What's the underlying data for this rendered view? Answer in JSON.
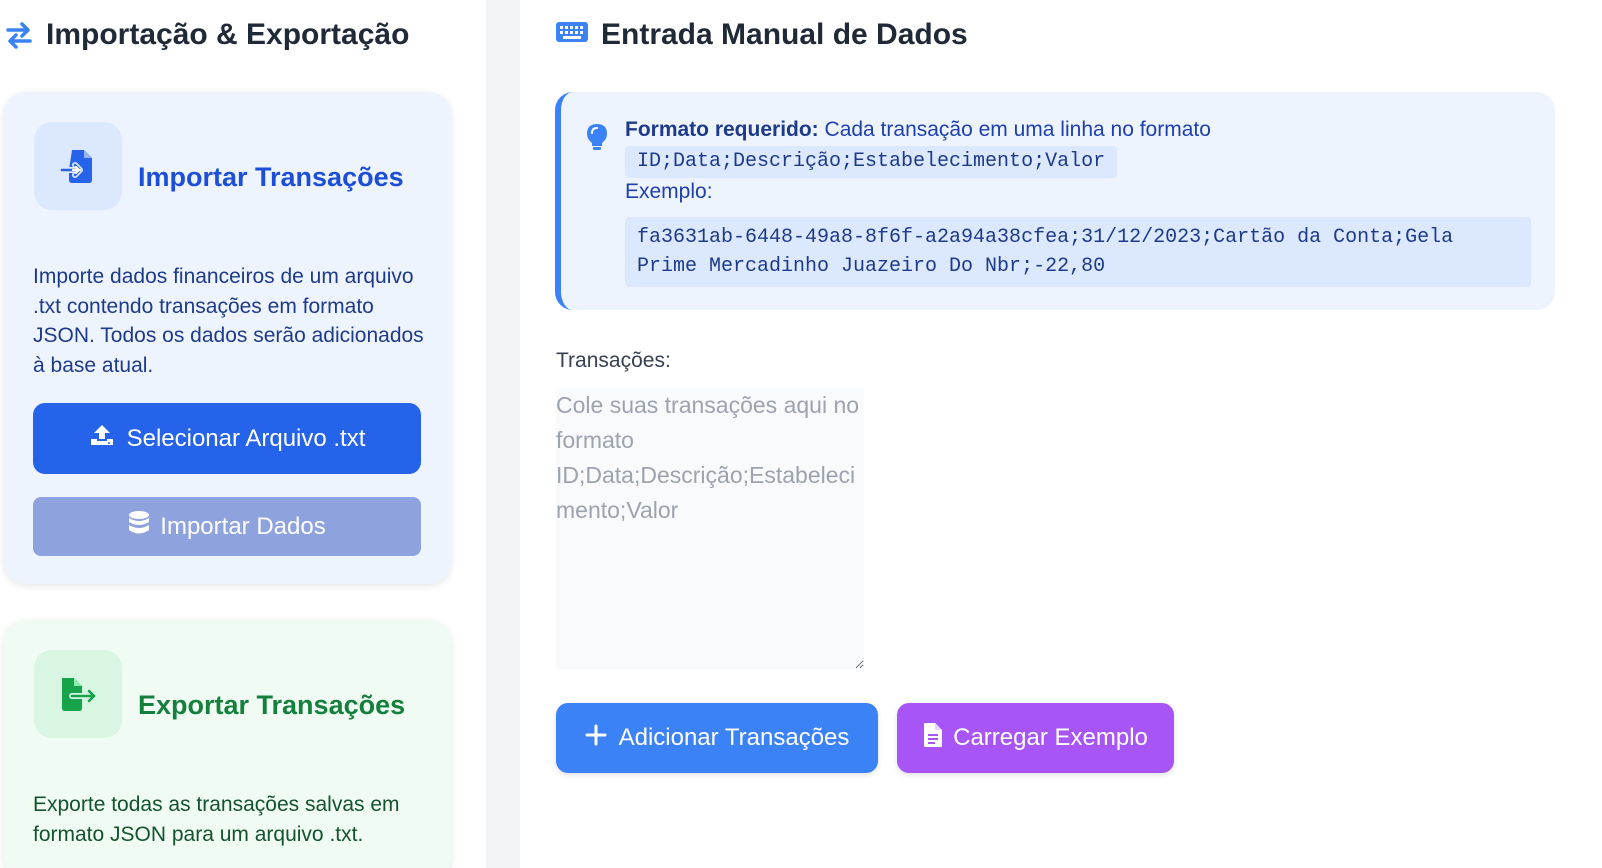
{
  "left_panel": {
    "title": "Importação & Exportação",
    "title_icon": "arrows-exchange-icon",
    "import_card": {
      "title": "Importar Transações",
      "icon": "file-import-icon",
      "description": "Importe dados financeiros de um arquivo .txt contendo transações em formato JSON. Todos os dados serão adicionados à base atual.",
      "select_button_label": "Selecionar Arquivo .txt",
      "import_button_label": "Importar Dados"
    },
    "export_card": {
      "title": "Exportar Transações",
      "icon": "file-export-icon",
      "description": "Exporte todas as transações salvas em formato JSON para um arquivo .txt."
    }
  },
  "right_panel": {
    "title": "Entrada Manual de Dados",
    "title_icon": "keyboard-icon",
    "info": {
      "label": "Formato requerido:",
      "text": " Cada transação em uma linha no formato",
      "format_code": "ID;Data;Descrição;Estabelecimento;Valor",
      "example_label": "Exemplo:",
      "example_line1": "fa3631ab-6448-49a8-8f6f-a2a94a38cfea;31/12/2023;Cartão da Conta;Gela",
      "example_line2": "Prime Mercadinho Juazeiro Do Nbr;-22,80"
    },
    "transactions": {
      "label": "Transações:",
      "placeholder": "Cole suas transações aqui no formato ID;Data;Descrição;Estabelecimento;Valor",
      "value": ""
    },
    "add_button_label": "Adicionar Transações",
    "example_button_label": "Carregar Exemplo"
  },
  "colors": {
    "primary": "#2563eb",
    "primary_light": "#3b82f6",
    "disabled": "#8ea3dd",
    "purple": "#a855f7",
    "export_green": "#15803d"
  }
}
